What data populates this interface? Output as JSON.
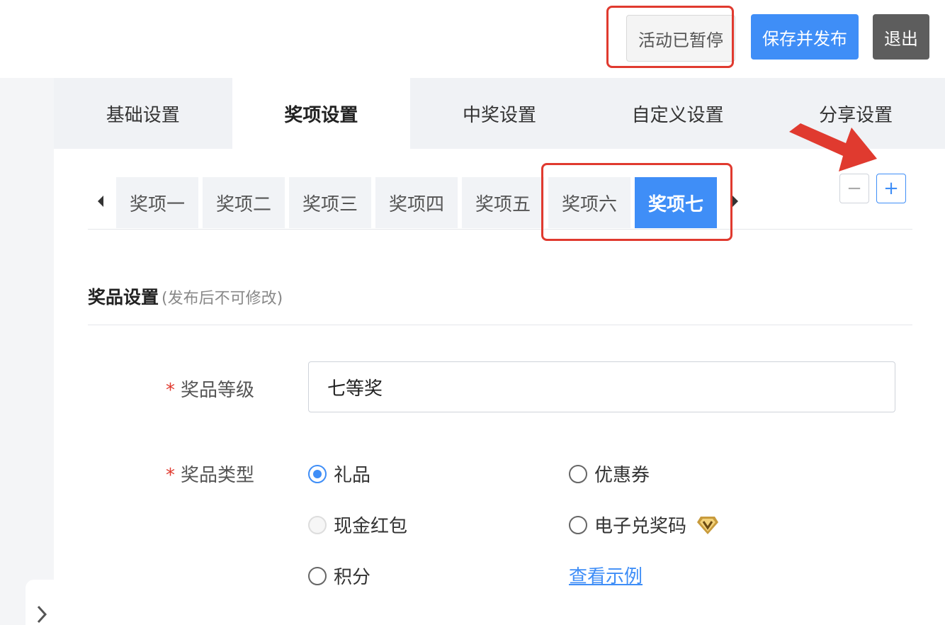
{
  "header": {
    "paused_label": "活动已暂停",
    "publish_label": "保存并发布",
    "exit_label": "退出"
  },
  "main_tabs": [
    {
      "label": "基础设置",
      "active": false
    },
    {
      "label": "奖项设置",
      "active": true
    },
    {
      "label": "中奖设置",
      "active": false
    },
    {
      "label": "自定义设置",
      "active": false
    },
    {
      "label": "分享设置",
      "active": false
    }
  ],
  "award_tabs": [
    {
      "label": "奖项一"
    },
    {
      "label": "奖项二"
    },
    {
      "label": "奖项三"
    },
    {
      "label": "奖项四"
    },
    {
      "label": "奖项五"
    },
    {
      "label": "奖项六"
    },
    {
      "label": "奖项七",
      "active": true
    }
  ],
  "stepper": {
    "minus": "−",
    "plus": "+"
  },
  "section": {
    "title": "奖品设置",
    "note": "(发布后不可修改)"
  },
  "form": {
    "required_mark": "*",
    "level_label": "奖品等级",
    "level_value": "七等奖",
    "type_label": "奖品类型",
    "types": [
      {
        "label": "礼品",
        "checked": true
      },
      {
        "label": "优惠券"
      },
      {
        "label": "现金红包",
        "disabled": true
      },
      {
        "label": "电子兑奖码",
        "vip": true
      },
      {
        "label": "积分"
      }
    ],
    "example_link": "查看示例"
  },
  "colors": {
    "accent": "#3f8ef7",
    "highlight": "#e03a2f",
    "exit_bg": "#5d5d5d"
  },
  "icons": {
    "scroll_left": "caret-left-icon",
    "scroll_right": "caret-right-icon",
    "collapse": "chevron-right-icon",
    "vip": "vip-diamond-icon"
  }
}
